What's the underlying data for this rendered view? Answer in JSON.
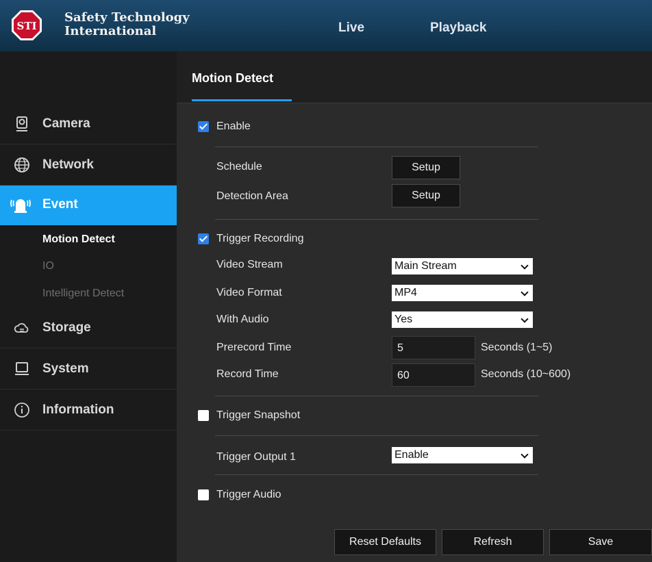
{
  "header": {
    "brand_line1": "Safety Technology",
    "brand_line2": "International",
    "logo_text": "STI",
    "nav": {
      "live": "Live",
      "playback": "Playback"
    }
  },
  "sidebar": {
    "items": [
      {
        "label": "Camera",
        "icon": "camera-icon"
      },
      {
        "label": "Network",
        "icon": "network-globe-icon"
      },
      {
        "label": "Event",
        "icon": "alarm-light-icon",
        "active": true
      },
      {
        "label": "Storage",
        "icon": "cloud-storage-icon"
      },
      {
        "label": "System",
        "icon": "monitor-icon"
      },
      {
        "label": "Information",
        "icon": "info-icon"
      }
    ],
    "event_sub": [
      "Motion Detect",
      "IO",
      "Intelligent Detect"
    ]
  },
  "main": {
    "tab": "Motion Detect",
    "enable": {
      "label": "Enable",
      "checked": true
    },
    "schedule": {
      "label": "Schedule",
      "button": "Setup"
    },
    "detection_area": {
      "label": "Detection Area",
      "button": "Setup"
    },
    "trigger_recording": {
      "label": "Trigger Recording",
      "checked": true
    },
    "video_stream": {
      "label": "Video Stream",
      "value": "Main Stream"
    },
    "video_format": {
      "label": "Video Format",
      "value": "MP4"
    },
    "with_audio": {
      "label": "With Audio",
      "value": "Yes"
    },
    "prerecord_time": {
      "label": "Prerecord Time",
      "value": "5",
      "unit": "Seconds (1~5)"
    },
    "record_time": {
      "label": "Record Time",
      "value": "60",
      "unit": "Seconds (10~600)"
    },
    "trigger_snapshot": {
      "label": "Trigger Snapshot",
      "checked": false
    },
    "trigger_output": {
      "label": "Trigger Output 1",
      "value": "Enable"
    },
    "trigger_audio": {
      "label": "Trigger Audio",
      "checked": false
    },
    "buttons": {
      "reset": "Reset Defaults",
      "refresh": "Refresh",
      "save": "Save"
    }
  },
  "colors": {
    "accent": "#1ea0f0",
    "checkbox": "#2f7fe8",
    "sidebar_bg": "#1b1b1b",
    "main_bg": "#2b2b2b"
  }
}
